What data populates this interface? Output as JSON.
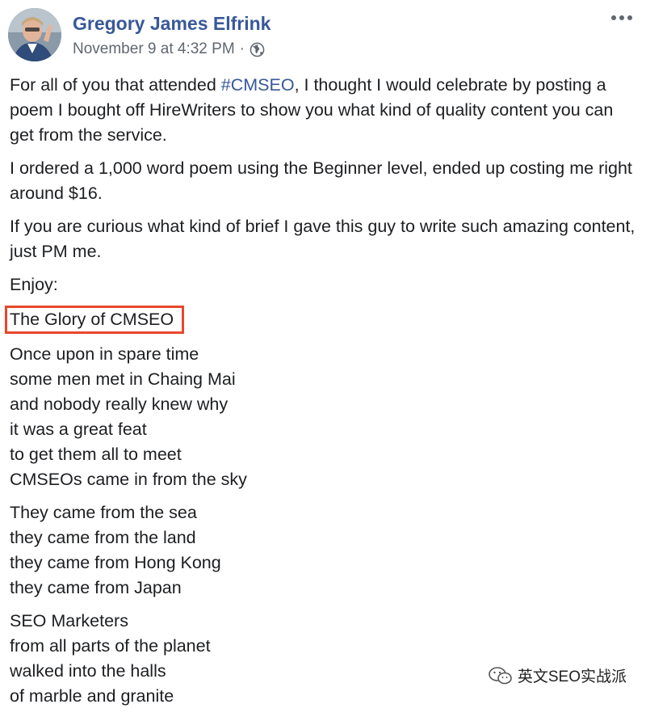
{
  "post": {
    "author": "Gregory James Elfrink",
    "date": "November 9 at 4:32 PM",
    "separator": "·",
    "privacy_icon": "globe-icon",
    "more_icon": "ellipsis-icon"
  },
  "body": {
    "p1_before": "For all of you that attended ",
    "p1_hashtag": "#CMSEO",
    "p1_after": ", I thought I would celebrate by posting a poem I bought off HireWriters to show you what kind of quality content you can get from the service.",
    "p2": "I ordered a 1,000 word poem using the Beginner level, ended up costing me right around $16.",
    "p3": "If you are curious what kind of brief I gave this guy to write such amazing content, just PM me.",
    "p4": "Enjoy:",
    "poem_title": "The Glory of CMSEO",
    "stanza1": [
      "Once upon in spare time",
      "some men met in Chaing Mai",
      "and nobody really knew why",
      "it was a great feat",
      "to get them all to meet",
      "CMSEOs came in from the sky"
    ],
    "stanza2": [
      "They came from the sea",
      "they came from the land",
      "they came from Hong Kong",
      "they came from Japan"
    ],
    "stanza3": [
      "SEO Marketers",
      "from all parts of the planet",
      "walked into the halls",
      "of marble and granite"
    ]
  },
  "watermark": {
    "text": "英文SEO实战派",
    "icon": "wechat-logo"
  },
  "colors": {
    "link": "#385898",
    "highlight_box": "#e8472b",
    "meta": "#606770"
  }
}
